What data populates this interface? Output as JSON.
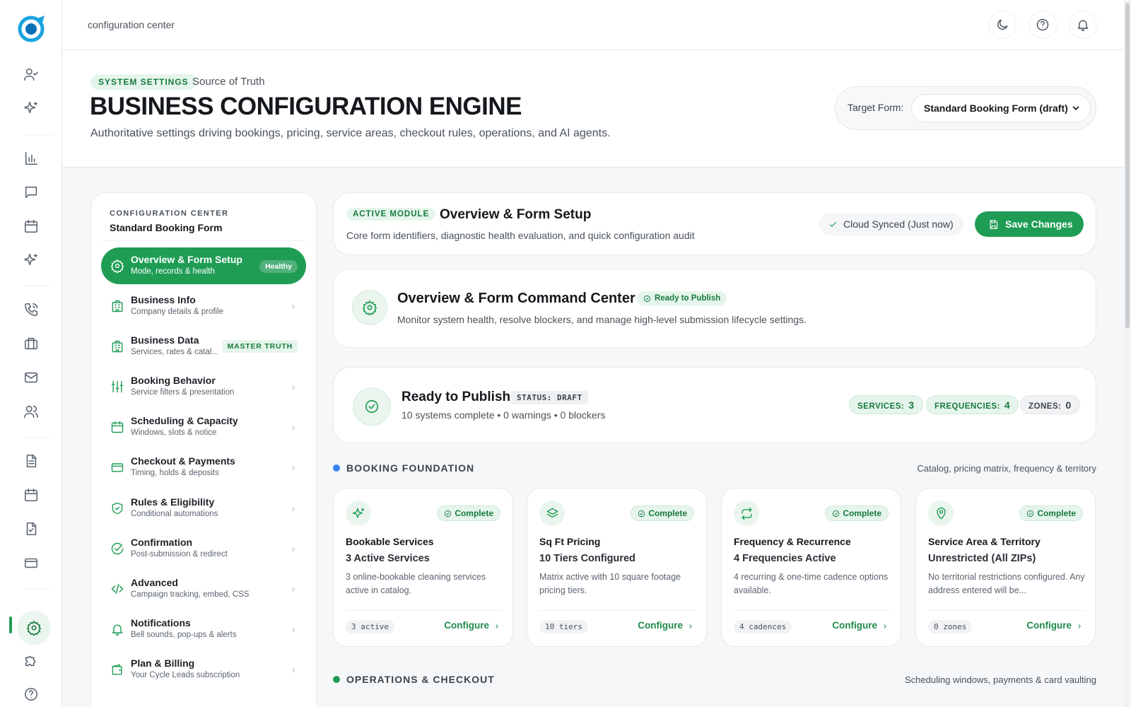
{
  "topbar": {
    "breadcrumb": "configuration center"
  },
  "header": {
    "pill": "SYSTEM SETTINGS",
    "source": "Source of Truth",
    "title": "BUSINESS CONFIGURATION ENGINE",
    "subtitle": "Authoritative settings driving bookings, pricing, service areas, checkout rules, operations, and AI agents.",
    "target_label": "Target Form:",
    "target_value": "Standard Booking Form (draft)"
  },
  "sidebar": {
    "caption": "CONFIGURATION CENTER",
    "title": "Standard Booking Form",
    "items": [
      {
        "label": "Overview & Form Setup",
        "desc": "Mode, records & health",
        "badge": "Healthy",
        "icon": "gear-icon"
      },
      {
        "label": "Business Info",
        "desc": "Company details & profile",
        "icon": "building-icon"
      },
      {
        "label": "Business Data",
        "desc": "Services, rates & catal...",
        "badge": "MASTER TRUTH",
        "icon": "building-icon"
      },
      {
        "label": "Booking Behavior",
        "desc": "Service filters & presentation",
        "icon": "sliders-icon"
      },
      {
        "label": "Scheduling & Capacity",
        "desc": "Windows, slots & notice",
        "icon": "calendar-icon"
      },
      {
        "label": "Checkout & Payments",
        "desc": "Timing, holds & deposits",
        "icon": "credit-card-icon"
      },
      {
        "label": "Rules & Eligibility",
        "desc": "Conditional automations",
        "icon": "shield-icon"
      },
      {
        "label": "Confirmation",
        "desc": "Post-submission & redirect",
        "icon": "check-circle-icon"
      },
      {
        "label": "Advanced",
        "desc": "Campaign tracking, embed, CSS",
        "icon": "code-icon"
      },
      {
        "label": "Notifications",
        "desc": "Bell sounds, pop-ups & alerts",
        "icon": "bell-icon"
      },
      {
        "label": "Plan & Billing",
        "desc": "Your Cycle Leads subscription",
        "icon": "wallet-icon"
      }
    ]
  },
  "module": {
    "pill": "ACTIVE MODULE",
    "title": "Overview & Form Setup",
    "subtitle": "Core form identifiers, diagnostic health evaluation, and quick configuration audit",
    "synced": "Cloud Synced (Just now)",
    "save": "Save Changes"
  },
  "command_center": {
    "title": "Overview & Form Command Center",
    "badge": "Ready to Publish",
    "subtitle": "Monitor system health, resolve blockers, and manage high-level submission lifecycle settings."
  },
  "publish": {
    "title": "Ready to Publish",
    "status": "STATUS: DRAFT",
    "summary": "10 systems complete • 0 warnings • 0 blockers",
    "stats": [
      {
        "label": "SERVICES:",
        "value": "3"
      },
      {
        "label": "FREQUENCIES:",
        "value": "4"
      },
      {
        "label": "ZONES:",
        "value": "0"
      }
    ]
  },
  "sections": {
    "booking": {
      "title": "BOOKING FOUNDATION",
      "right": "Catalog, pricing matrix, frequency & territory",
      "dot_color": "#3b82f6"
    },
    "operations": {
      "title": "OPERATIONS & CHECKOUT",
      "right": "Scheduling windows, payments & card vaulting",
      "dot_color": "#1f9d55"
    }
  },
  "tiles": [
    {
      "name": "Bookable Services",
      "value": "3 Active Services",
      "desc": "3 online-bookable cleaning services active in catalog.",
      "chip": "3 active",
      "status": "Complete",
      "action": "Configure",
      "icon": "sparkle-icon"
    },
    {
      "name": "Sq Ft Pricing",
      "value": "10 Tiers Configured",
      "desc": "Matrix active with 10 square footage pricing tiers.",
      "chip": "10 tiers",
      "status": "Complete",
      "action": "Configure",
      "icon": "layers-icon"
    },
    {
      "name": "Frequency & Recurrence",
      "value": "4 Frequencies Active",
      "desc": "4 recurring & one-time cadence options available.",
      "chip": "4 cadences",
      "status": "Complete",
      "action": "Configure",
      "icon": "repeat-icon"
    },
    {
      "name": "Service Area & Territory",
      "value": "Unrestricted (All ZIPs)",
      "desc": "No territorial restrictions configured. Any address entered will be...",
      "chip": "0 zones",
      "status": "Complete",
      "action": "Configure",
      "icon": "map-pin-icon"
    }
  ],
  "colors": {
    "accent": "#1f9d55",
    "accent_soft": "#e6f5ec"
  }
}
